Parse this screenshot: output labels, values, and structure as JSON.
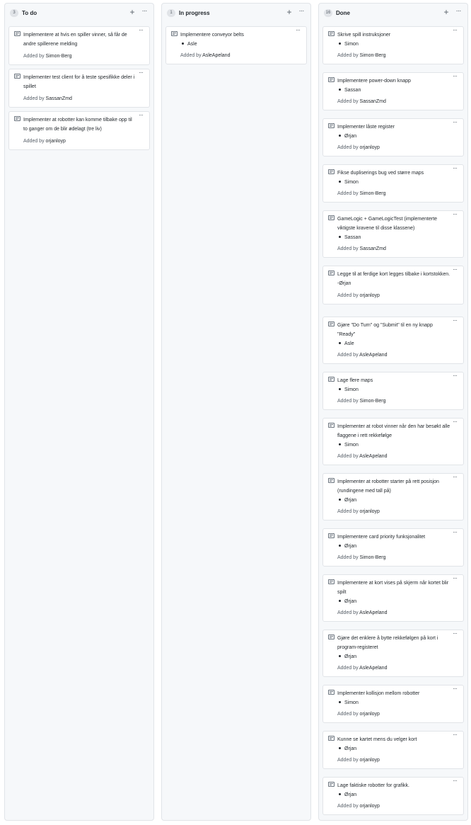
{
  "columns": [
    {
      "title": "To do",
      "count": "3",
      "cards": [
        {
          "title": "Implementere at hvis en spiller vinner, så får de andre spillerene melding",
          "assignee": "",
          "added_by_prefix": "Added by",
          "user": "Simon-Berg"
        },
        {
          "title": "Implementer test client for å teste spesifikke deler i spillet",
          "assignee": "",
          "added_by_prefix": "Added by",
          "user": "SassanZmd"
        },
        {
          "title": "Implementer at robotter kan komme tilbake opp til to ganger om de blir ødelagt (tre liv)",
          "assignee": "",
          "added_by_prefix": "Added by",
          "user": "orjanloyp"
        }
      ]
    },
    {
      "title": "In progress",
      "count": "1",
      "cards": [
        {
          "title": "Implementere conveyor belts",
          "assignee": "Asle",
          "added_by_prefix": "Added by",
          "user": "AsleApeland"
        }
      ]
    },
    {
      "title": "Done",
      "count": "16",
      "cards": [
        {
          "title": "Skrive spill instruksjoner",
          "assignee": "Simon",
          "added_by_prefix": "Added by",
          "user": "Simon-Berg"
        },
        {
          "title": "Implementere power-down knapp",
          "assignee": "Sassan",
          "added_by_prefix": "Added by",
          "user": "SassanZmd"
        },
        {
          "title": "Implementer låste register",
          "assignee": "Ørjan",
          "added_by_prefix": "Added by",
          "user": "orjanloyp"
        },
        {
          "title": "Fikse dupliserings bug ved større maps",
          "assignee": "Simon",
          "added_by_prefix": "Added by",
          "user": "Simon-Berg"
        },
        {
          "title": "GameLogic + GameLogicTest (implementerte viktigste kravene til disse klassene)",
          "assignee": "Sassan",
          "added_by_prefix": "Added by",
          "user": "SassanZmd"
        },
        {
          "title": "Legge til at ferdige kort legges tilbake i kortstokken.\n-Ørjan",
          "assignee": "",
          "added_by_prefix": "Added by",
          "user": "orjanloyp"
        },
        {
          "title": "Gjøre \"Do Turn\" og \"Submit\" til en ny knapp \"Ready\"",
          "assignee": "Asle",
          "added_by_prefix": "Added by",
          "user": "AsleApeland"
        },
        {
          "title": "Lage flere maps",
          "assignee": "Simon",
          "added_by_prefix": "Added by",
          "user": "Simon-Berg"
        },
        {
          "title": "Implementer at robot vinner når den har besøkt alle flaggene i rett rekkefølge",
          "assignee": "Simon",
          "added_by_prefix": "Added by",
          "user": "AsleApeland"
        },
        {
          "title": "Implementer at robotter starter på rett posisjon (rundingene med tall på)",
          "assignee": "Ørjan",
          "added_by_prefix": "Added by",
          "user": "orjanloyp"
        },
        {
          "title": "Implementere card priority funksjonalitet",
          "assignee": "Ørjan",
          "added_by_prefix": "Added by",
          "user": "Simon-Berg"
        },
        {
          "title": "Implementere at kort vises på skjerm når kortet blir spilt",
          "assignee": "Ørjan",
          "added_by_prefix": "Added by",
          "user": "AsleApeland"
        },
        {
          "title": "Gjøre det enklere å bytte rekkefølgen på kort i program-registeret",
          "assignee": "Ørjan",
          "added_by_prefix": "Added by",
          "user": "AsleApeland"
        },
        {
          "title": "Implementer kollisjon mellom robotter",
          "assignee": "Simon",
          "added_by_prefix": "Added by",
          "user": "orjanloyp"
        },
        {
          "title": "Kunne se kartet mens du velger kort",
          "assignee": "Ørjan",
          "added_by_prefix": "Added by",
          "user": "orjanloyp"
        },
        {
          "title": "Lage faktiske robotter for grafikk.",
          "assignee": "Ørjan",
          "added_by_prefix": "Added by",
          "user": "orjanloyp"
        }
      ]
    }
  ],
  "icons": {
    "add": "+",
    "more": "···",
    "note_icon": "note-icon",
    "plus_icon": "plus-icon",
    "kebab_icon": "more-horizontal-icon"
  },
  "colors": {
    "column_bg": "#f6f8fa",
    "card_border": "#e1e4e8",
    "text": "#24292e",
    "muted": "#586069"
  }
}
